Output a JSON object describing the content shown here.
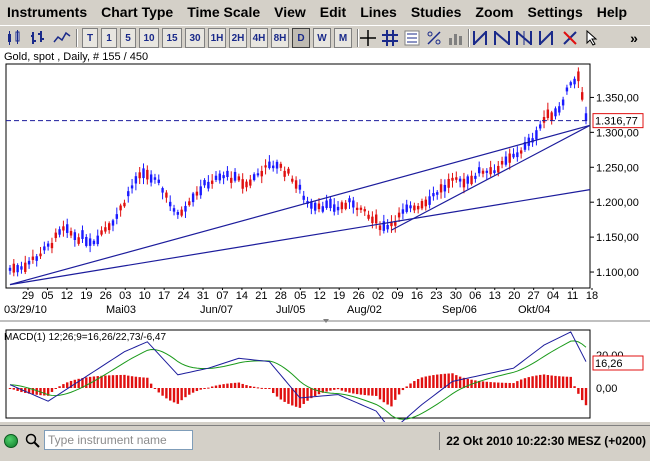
{
  "menu": [
    "Instruments",
    "Chart Type",
    "Time Scale",
    "View",
    "Edit",
    "Lines",
    "Studies",
    "Zoom",
    "Settings",
    "Help"
  ],
  "toolbar": {
    "timeframes": [
      "T",
      "1",
      "5",
      "10",
      "15",
      "30",
      "1H",
      "2H",
      "4H",
      "8H",
      "D",
      "W",
      "M"
    ],
    "selected_timeframe": "D",
    "more": "»"
  },
  "chart": {
    "title": "Gold, spot , Daily, # 155 / 450",
    "current_price": "1.316,77",
    "macd_label": "MACD(1) 12;26;9=16,26/22,73/-6,47",
    "macd_value": "16,26",
    "macd_top_value": "20,00",
    "macd_zero": "0,00"
  },
  "chart_data": {
    "type": "candlestick",
    "title": "Gold, spot , Daily, # 155 / 450",
    "y_ticks": [
      "1.350,00",
      "1.300,00",
      "1.250,00",
      "1.200,00",
      "1.150,00",
      "1.100,00"
    ],
    "y_tick_values": [
      1350,
      1300,
      1250,
      1200,
      1150,
      1100
    ],
    "ylim": [
      1080,
      1395
    ],
    "day_ticks": [
      "29",
      "05",
      "12",
      "19",
      "26",
      "03",
      "10",
      "17",
      "24",
      "31",
      "07",
      "14",
      "21",
      "28",
      "05",
      "12",
      "19",
      "26",
      "02",
      "09",
      "16",
      "23",
      "30",
      "06",
      "13",
      "20",
      "27",
      "04",
      "11",
      "18"
    ],
    "month_labels": [
      "03/29/10",
      "Mai03",
      "Jun/07",
      "Jul/05",
      "Aug/02",
      "Sep/06",
      "Okt/04"
    ],
    "current_price": 1316.77,
    "trendlines": [
      {
        "from": [
          0,
          1082
        ],
        "to": [
          151,
          1310
        ]
      },
      {
        "from": [
          0,
          1082
        ],
        "to": [
          151,
          1218
        ]
      }
    ],
    "macd": {
      "params": "12;26;9",
      "macd": 16.26,
      "signal": 22.73,
      "histogram": -6.47,
      "y_ticks": [
        "20,00",
        "0,00"
      ]
    }
  },
  "status": {
    "search_placeholder": "Type instrument name",
    "datetime": "22 Okt 2010 10:22:30 MESZ (+0200)"
  },
  "colors": {
    "up_candle": "#1a1aff",
    "down_candle": "#e01010",
    "trendline": "#1c1c9c",
    "macd_line": "#1c1c9c",
    "signal_line": "#1a9a1a",
    "histogram": "#e01010"
  }
}
